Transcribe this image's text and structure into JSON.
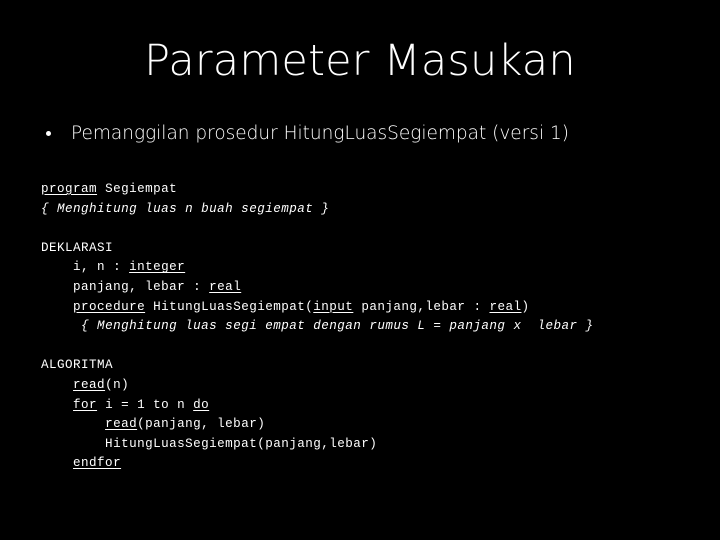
{
  "slide": {
    "title": "Parameter Masukan",
    "background_color": "#000000",
    "text_color": "#ffffff",
    "bullets": [
      {
        "marker": "bullet-dot",
        "text": "Pemanggilan prosedur HitungLuasSegiempat (versi 1)"
      }
    ],
    "code": {
      "language": "notasi-algoritmik",
      "lines": [
        {
          "id": "line-1",
          "segments": [
            {
              "text": "program",
              "style": "keyword"
            },
            {
              "text": " Segiempat",
              "style": "plain"
            }
          ]
        },
        {
          "id": "line-2",
          "segments": [
            {
              "text": "{ Menghitung luas n buah segiempat }",
              "style": "comment"
            }
          ]
        },
        {
          "id": "line-3",
          "segments": [
            {
              "text": "",
              "style": "plain"
            }
          ]
        },
        {
          "id": "line-4",
          "segments": [
            {
              "text": "DEKLARASI",
              "style": "plain"
            }
          ]
        },
        {
          "id": "line-5",
          "segments": [
            {
              "text": "    i, n : ",
              "style": "plain"
            },
            {
              "text": "integer",
              "style": "keyword"
            }
          ]
        },
        {
          "id": "line-6",
          "segments": [
            {
              "text": "    panjang, lebar : ",
              "style": "plain"
            },
            {
              "text": "real",
              "style": "keyword"
            }
          ]
        },
        {
          "id": "line-7",
          "segments": [
            {
              "text": "    ",
              "style": "plain"
            },
            {
              "text": "procedure",
              "style": "keyword"
            },
            {
              "text": " HitungLuasSegiempat(",
              "style": "plain"
            },
            {
              "text": "input",
              "style": "keyword"
            },
            {
              "text": " panjang,lebar : ",
              "style": "plain"
            },
            {
              "text": "real",
              "style": "keyword"
            },
            {
              "text": ")",
              "style": "plain"
            }
          ]
        },
        {
          "id": "line-8",
          "segments": [
            {
              "text": "     ",
              "style": "plain"
            },
            {
              "text": "{ Menghitung luas segi empat dengan rumus L = panjang x  lebar }",
              "style": "comment"
            }
          ]
        },
        {
          "id": "line-9",
          "segments": [
            {
              "text": "",
              "style": "plain"
            }
          ]
        },
        {
          "id": "line-10",
          "segments": [
            {
              "text": "ALGORITMA",
              "style": "plain"
            }
          ]
        },
        {
          "id": "line-11",
          "segments": [
            {
              "text": "    ",
              "style": "plain"
            },
            {
              "text": "read",
              "style": "keyword"
            },
            {
              "text": "(n)",
              "style": "plain"
            }
          ]
        },
        {
          "id": "line-12",
          "segments": [
            {
              "text": "    ",
              "style": "plain"
            },
            {
              "text": "for",
              "style": "keyword"
            },
            {
              "text": " i = 1 to n ",
              "style": "plain"
            },
            {
              "text": "do",
              "style": "keyword"
            }
          ]
        },
        {
          "id": "line-13",
          "segments": [
            {
              "text": "        ",
              "style": "plain"
            },
            {
              "text": "read",
              "style": "keyword"
            },
            {
              "text": "(panjang, lebar)",
              "style": "plain"
            }
          ]
        },
        {
          "id": "line-14",
          "segments": [
            {
              "text": "        HitungLuasSegiempat(panjang,lebar)",
              "style": "plain"
            }
          ]
        },
        {
          "id": "line-15",
          "segments": [
            {
              "text": "    ",
              "style": "plain"
            },
            {
              "text": "endfor",
              "style": "keyword"
            }
          ]
        }
      ]
    }
  }
}
